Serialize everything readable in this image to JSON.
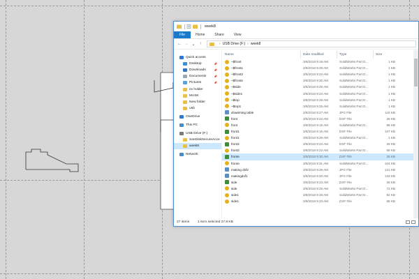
{
  "window": {
    "title": "week8",
    "tabs": [
      "File",
      "Home",
      "Share",
      "View"
    ],
    "address": [
      "USB Drive (F:)",
      "week8"
    ]
  },
  "columns": {
    "name": "Name",
    "date": "Date modified",
    "type": "Type",
    "size": "Size"
  },
  "nav": [
    {
      "label": "Quick access",
      "icon": "star-icon",
      "color": "#2b7bd6",
      "indent": false,
      "pin": false,
      "sel": false,
      "gap": false
    },
    {
      "label": "Desktop",
      "icon": "desktop-icon",
      "color": "#3a8fd9",
      "indent": true,
      "pin": true,
      "sel": false,
      "gap": false
    },
    {
      "label": "Downloads",
      "icon": "download-icon",
      "color": "#2f78c4",
      "indent": true,
      "pin": true,
      "sel": false,
      "gap": false
    },
    {
      "label": "Documents",
      "icon": "documents-icon",
      "color": "#9aa7b5",
      "indent": true,
      "pin": true,
      "sel": false,
      "gap": false
    },
    {
      "label": "Pictures",
      "icon": "pictures-icon",
      "color": "#5aa0d6",
      "indent": true,
      "pin": true,
      "sel": false,
      "gap": false
    },
    {
      "label": "ex holder",
      "icon": "folder-icon",
      "color": "#e8c046",
      "indent": true,
      "pin": false,
      "sel": false,
      "gap": false
    },
    {
      "label": "MASK",
      "icon": "folder-icon",
      "color": "#e8c046",
      "indent": true,
      "pin": false,
      "sel": false,
      "gap": false
    },
    {
      "label": "New folder",
      "icon": "folder-icon",
      "color": "#e8c046",
      "indent": true,
      "pin": false,
      "sel": false,
      "gap": false
    },
    {
      "label": "usb",
      "icon": "folder-icon",
      "color": "#e8c046",
      "indent": true,
      "pin": false,
      "sel": false,
      "gap": false
    },
    {
      "label": "OneDrive",
      "icon": "cloud-icon",
      "color": "#2b7bd6",
      "indent": false,
      "pin": false,
      "sel": false,
      "gap": true
    },
    {
      "label": "This PC",
      "icon": "computer-icon",
      "color": "#4a8ac9",
      "indent": false,
      "pin": false,
      "sel": false,
      "gap": true
    },
    {
      "label": "USB Drive (F:)",
      "icon": "drive-icon",
      "color": "#7a7a7a",
      "indent": false,
      "pin": false,
      "sel": false,
      "gap": true
    },
    {
      "label": "SanDiskSecureAcce",
      "icon": "folder-icon",
      "color": "#e8c046",
      "indent": true,
      "pin": false,
      "sel": false,
      "gap": false
    },
    {
      "label": "week8",
      "icon": "folder-icon",
      "color": "#e8c046",
      "indent": true,
      "pin": false,
      "sel": true,
      "gap": false
    },
    {
      "label": "Network",
      "icon": "network-icon",
      "color": "#4a8ac9",
      "indent": false,
      "pin": false,
      "sel": false,
      "gap": true
    }
  ],
  "files": [
    {
      "name": "~$front",
      "date": "3/8/2018 9:19 AM",
      "type": "SolidWorks Part D...",
      "size": "1 KB",
      "kind": "sw"
    },
    {
      "name": "~$front1",
      "date": "3/8/2018 9:29 AM",
      "type": "SolidWorks Part D...",
      "size": "1 KB",
      "kind": "sw"
    },
    {
      "name": "~$front2",
      "date": "3/8/2018 9:22 AM",
      "type": "SolidWorks Part D...",
      "size": "1 KB",
      "kind": "sw"
    },
    {
      "name": "~$fronte",
      "date": "3/8/2018 9:30 AM",
      "type": "SolidWorks Part D...",
      "size": "1 KB",
      "kind": "sw"
    },
    {
      "name": "~$side",
      "date": "3/8/2018 9:25 AM",
      "type": "SolidWorks Part D...",
      "size": "1 KB",
      "kind": "sw"
    },
    {
      "name": "~$side1",
      "date": "3/8/2018 9:23 AM",
      "type": "SolidWorks Part D...",
      "size": "1 KB",
      "kind": "sw"
    },
    {
      "name": "~$top",
      "date": "3/8/2018 9:25 AM",
      "type": "SolidWorks Part D...",
      "size": "1 KB",
      "kind": "sw"
    },
    {
      "name": "~$top1",
      "date": "3/8/2018 9:25 AM",
      "type": "SolidWorks Part D...",
      "size": "1 KB",
      "kind": "sw"
    },
    {
      "name": "drawiming table",
      "date": "3/8/2018 9:27 AM",
      "type": "JPG File",
      "size": "116 KB",
      "kind": "jpg"
    },
    {
      "name": "front",
      "date": "3/8/2018 9:22 AM",
      "type": "DXF File",
      "size": "26 KB",
      "kind": "dxf"
    },
    {
      "name": "front",
      "date": "3/8/2018 9:19 AM",
      "type": "SolidWorks Part D...",
      "size": "95 KB",
      "kind": "sw"
    },
    {
      "name": "front1",
      "date": "3/8/2018 9:19 AM",
      "type": "DXF File",
      "size": "107 KB",
      "kind": "dxf"
    },
    {
      "name": "front1",
      "date": "3/8/2018 9:29 AM",
      "type": "SolidWorks Part D...",
      "size": "1 KB",
      "kind": "sw"
    },
    {
      "name": "front2",
      "date": "3/8/2018 9:23 AM",
      "type": "DXF File",
      "size": "26 KB",
      "kind": "dxf"
    },
    {
      "name": "front2",
      "date": "3/8/2018 9:22 AM",
      "type": "SolidWorks Part D...",
      "size": "68 KB",
      "kind": "sw"
    },
    {
      "name": "fronte",
      "date": "3/8/2018 9:30 AM",
      "type": "DXF File",
      "size": "28 KB",
      "kind": "dxf",
      "sel": true
    },
    {
      "name": "fronte",
      "date": "3/8/2018 9:31 AM",
      "type": "SolidWorks Part D...",
      "size": "104 KB",
      "kind": "sw"
    },
    {
      "name": "making dxf2",
      "date": "3/8/2018 9:29 AM",
      "type": "JPG File",
      "size": "121 KB",
      "kind": "jpg"
    },
    {
      "name": "makingdxf1",
      "date": "3/8/2018 9:20 AM",
      "type": "JPG File",
      "size": "133 KB",
      "kind": "jpg"
    },
    {
      "name": "side",
      "date": "3/8/2018 9:23 AM",
      "type": "DXF File",
      "size": "26 KB",
      "kind": "dxf"
    },
    {
      "name": "side",
      "date": "3/8/2018 9:25 AM",
      "type": "SolidWorks Part D...",
      "size": "72 KB",
      "kind": "sw"
    },
    {
      "name": "side1",
      "date": "3/8/2018 9:25 AM",
      "type": "SolidWorks Part D...",
      "size": "82 KB",
      "kind": "sw"
    },
    {
      "name": "side1",
      "date": "3/8/2018 9:23 AM",
      "type": "DXF File",
      "size": "68 KB",
      "kind": "sw"
    }
  ],
  "status": {
    "count": "27 items",
    "selected": "1 item selected  27.8 KB"
  },
  "colors": {
    "accent": "#1979ca",
    "selection": "#cce8ff",
    "border": "#4a90d9"
  }
}
